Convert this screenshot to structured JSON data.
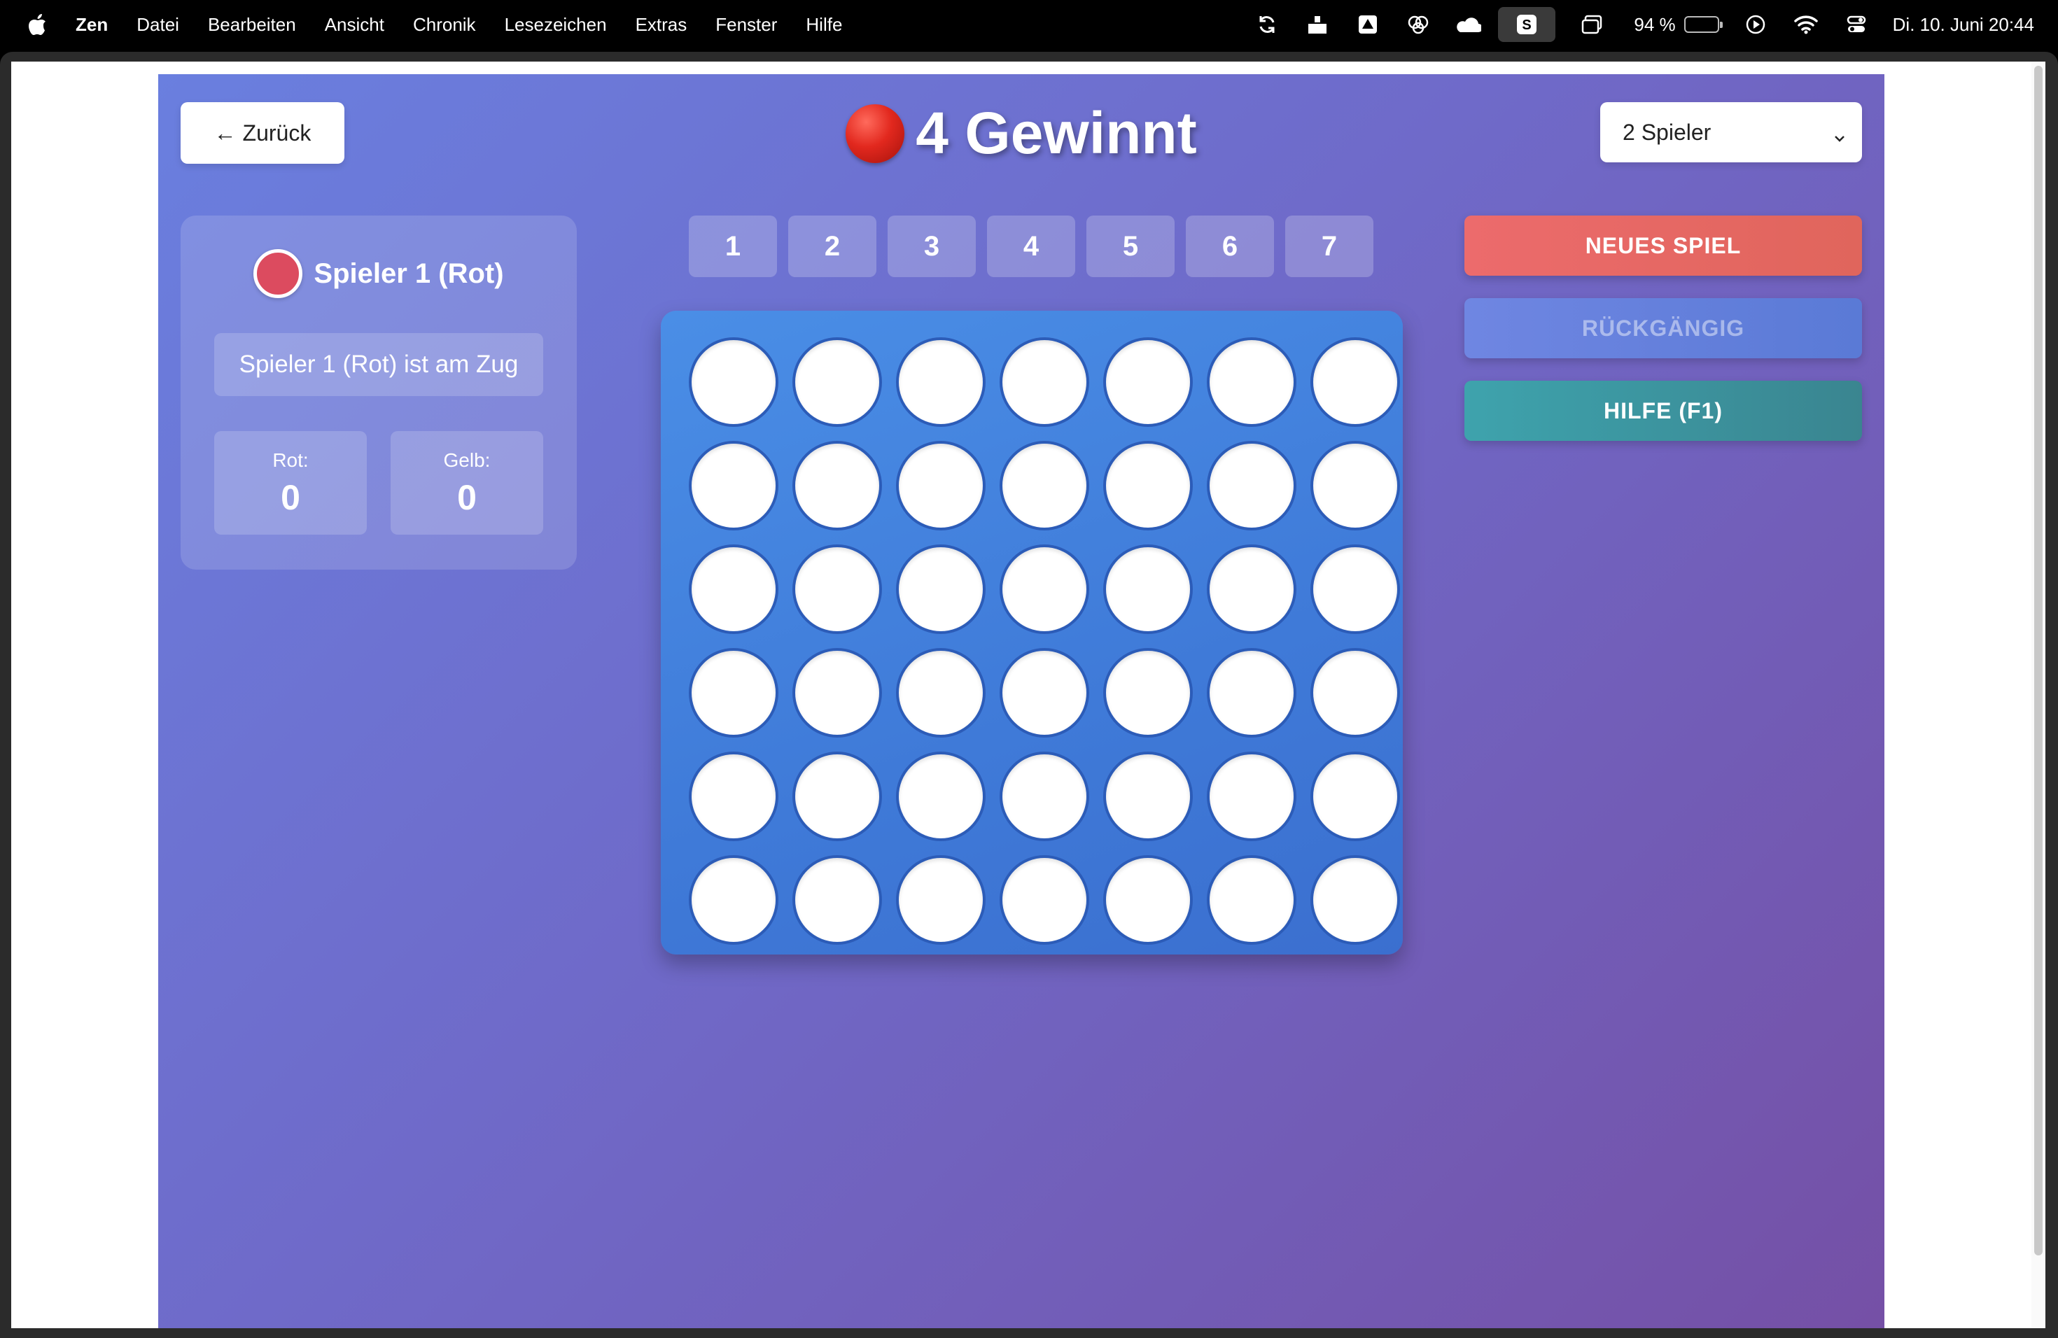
{
  "menubar": {
    "app_name": "Zen",
    "items": [
      "Datei",
      "Bearbeiten",
      "Ansicht",
      "Chronik",
      "Lesezeichen",
      "Extras",
      "Fenster",
      "Hilfe"
    ],
    "battery_percent": "94 %",
    "battery_level": 0.94,
    "datetime": "Di. 10. Juni  20:44",
    "tray_icons": [
      "sync-icon",
      "share-icon",
      "drive-icon",
      "brain-icon",
      "cloud-icon",
      "s-app-icon",
      "window-icon",
      "play-icon",
      "wifi-icon",
      "control-center-icon"
    ]
  },
  "game": {
    "back_label": "← Zurück",
    "title": "4 Gewinnt",
    "mode_selected": "2 Spieler",
    "current_player": "Spieler 1 (Rot)",
    "status": "Spieler 1 (Rot) ist am Zug",
    "score": {
      "red_label": "Rot:",
      "red_value": "0",
      "yellow_label": "Gelb:",
      "yellow_value": "0"
    },
    "columns": [
      "1",
      "2",
      "3",
      "4",
      "5",
      "6",
      "7"
    ],
    "board": {
      "rows": 6,
      "cols": 7,
      "cells": [
        [
          "empty",
          "empty",
          "empty",
          "empty",
          "empty",
          "empty",
          "empty"
        ],
        [
          "empty",
          "empty",
          "empty",
          "empty",
          "empty",
          "empty",
          "empty"
        ],
        [
          "empty",
          "empty",
          "empty",
          "empty",
          "empty",
          "empty",
          "empty"
        ],
        [
          "empty",
          "empty",
          "empty",
          "empty",
          "empty",
          "empty",
          "empty"
        ],
        [
          "empty",
          "empty",
          "empty",
          "empty",
          "empty",
          "empty",
          "empty"
        ],
        [
          "empty",
          "empty",
          "empty",
          "empty",
          "empty",
          "empty",
          "empty"
        ]
      ]
    },
    "actions": {
      "new_game": "NEUES SPIEL",
      "undo": "RÜCKGÄNGIG",
      "help": "HILFE (F1)"
    },
    "colors": {
      "red_player": "#dc4b5f",
      "board": "#3f7ad8",
      "new_game": "#e8695f",
      "help": "#3d929c"
    }
  }
}
